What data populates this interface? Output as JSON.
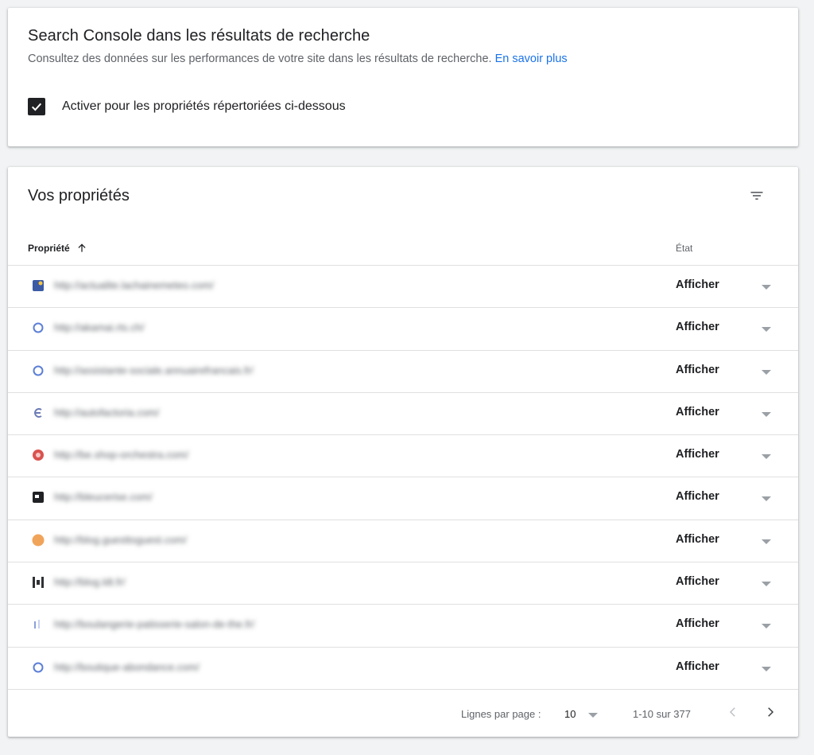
{
  "serp_card": {
    "title": "Search Console dans les résultats de recherche",
    "description": "Consultez des données sur les performances de votre site dans les résultats de recherche.",
    "learn_more": "En savoir plus",
    "checkbox_label": "Activer pour les propriétés répertoriées ci-dessous",
    "checked": true
  },
  "properties_card": {
    "title": "Vos propriétés",
    "columns": {
      "property": "Propriété",
      "state": "État"
    },
    "rows": [
      {
        "url": "http://actualite.lachainemeteo.com/",
        "state": "Afficher",
        "favicon": "weather-icon",
        "color": "#3b5ba5"
      },
      {
        "url": "http://akamai.rts.ch/",
        "state": "Afficher",
        "favicon": "globe-icon",
        "color": "#5c7fd6"
      },
      {
        "url": "http://assistante-sociale.annuairefrancais.fr/",
        "state": "Afficher",
        "favicon": "globe-icon",
        "color": "#5c7fd6"
      },
      {
        "url": "http://autofactoria.com/",
        "state": "Afficher",
        "favicon": "letter-e-icon",
        "color": "#6b7bb5"
      },
      {
        "url": "http://be.shop-orchestra.com/",
        "state": "Afficher",
        "favicon": "orchestra-icon",
        "color": "#d9534f"
      },
      {
        "url": "http://bleucerise.com/",
        "state": "Afficher",
        "favicon": "square-dark-icon",
        "color": "#202124"
      },
      {
        "url": "http://blog.guesttoguest.com/",
        "state": "Afficher",
        "favicon": "circle-orange-icon",
        "color": "#f0a45a"
      },
      {
        "url": "http://blog.ldt.fr/",
        "state": "Afficher",
        "favicon": "bracket-icon",
        "color": "#303134"
      },
      {
        "url": "http://boulangerie-patisserie-salon-de-the.fr/",
        "state": "Afficher",
        "favicon": "bars-icon",
        "color": "#8aa2d9"
      },
      {
        "url": "http://boutique-abondance.com/",
        "state": "Afficher",
        "favicon": "globe-icon",
        "color": "#5c7fd6"
      }
    ]
  },
  "pagination": {
    "rows_per_page_label": "Lignes par page :",
    "rows_per_page": "10",
    "range": "1-10 sur 377"
  }
}
